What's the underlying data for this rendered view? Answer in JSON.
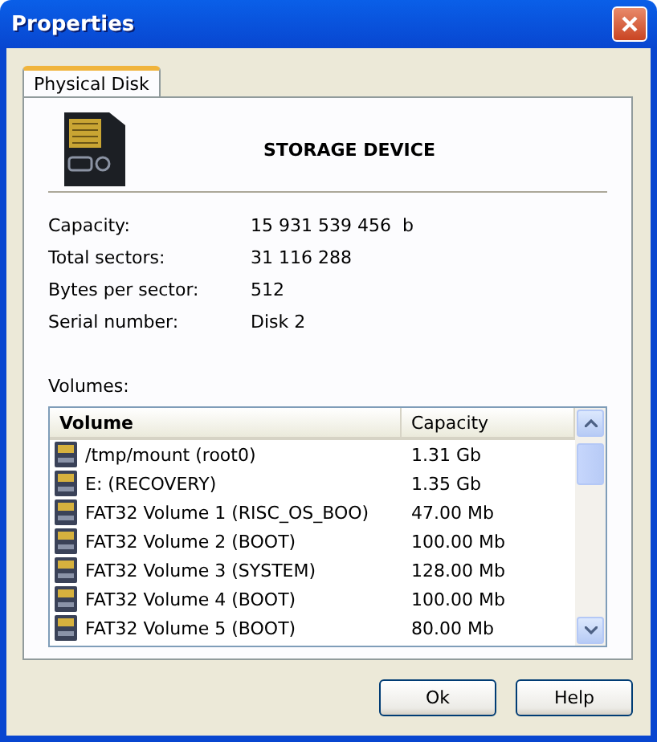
{
  "window": {
    "title": "Properties"
  },
  "tabs": [
    {
      "label": "Physical Disk",
      "selected": true
    }
  ],
  "device": {
    "name": "STORAGE DEVICE"
  },
  "properties": [
    {
      "label": "Capacity:",
      "value": "15 931 539 456  b"
    },
    {
      "label": "Total sectors:",
      "value": "31 116 288"
    },
    {
      "label": "Bytes per sector:",
      "value": "512"
    },
    {
      "label": "Serial number:",
      "value": "Disk 2"
    }
  ],
  "volumes": {
    "label": "Volumes:",
    "columns": [
      "Volume",
      "Capacity"
    ],
    "rows": [
      {
        "volume": "/tmp/mount (root0)",
        "capacity": "1.31 Gb"
      },
      {
        "volume": "E: (RECOVERY)",
        "capacity": "1.35 Gb"
      },
      {
        "volume": "FAT32 Volume 1 (RISC_OS_BOO)",
        "capacity": "47.00 Mb"
      },
      {
        "volume": "FAT32 Volume 2 (BOOT)",
        "capacity": "100.00 Mb"
      },
      {
        "volume": "FAT32 Volume 3 (SYSTEM)",
        "capacity": "128.00 Mb"
      },
      {
        "volume": "FAT32 Volume 4 (BOOT)",
        "capacity": "100.00 Mb"
      },
      {
        "volume": "FAT32 Volume 5 (BOOT)",
        "capacity": "80.00 Mb"
      }
    ]
  },
  "buttons": [
    "Ok",
    "Help"
  ]
}
